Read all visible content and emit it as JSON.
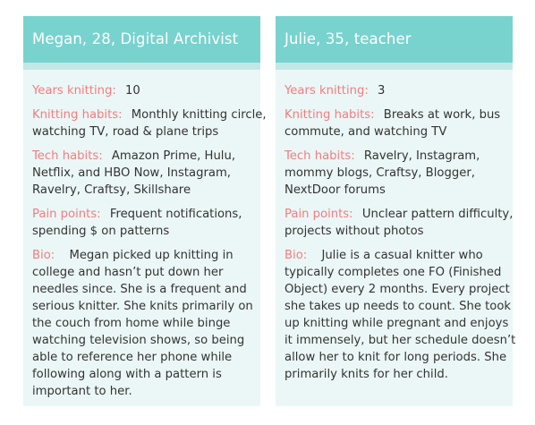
{
  "personas": [
    {
      "title": "Megan, 28, Digital Archivist",
      "fields": [
        {
          "label": "Years knitting:",
          "value": "10"
        },
        {
          "label": "Knitting habits:",
          "value": "Monthly knitting circle, watching TV, road & plane trips"
        },
        {
          "label": "Tech habits:",
          "value": "Amazon Prime, Hulu, Netflix, and HBO Now, Instagram, Ravelry, Craftsy, Skillshare"
        },
        {
          "label": "Pain points:",
          "value": "Frequent notifications, spending $ on patterns"
        },
        {
          "label": "Bio:",
          "value": "Megan picked up knitting in college and hasn’t put down her needles since. She is a frequent and serious knitter. She knits primarily on the couch from home while binge watching television shows, so being able to reference her phone while following along with a pattern is important to her."
        }
      ]
    },
    {
      "title": "Julie, 35, teacher",
      "fields": [
        {
          "label": "Years knitting:",
          "value": "3"
        },
        {
          "label": "Knitting habits:",
          "value": "Breaks at work, bus commute, and watching TV"
        },
        {
          "label": "Tech habits:",
          "value": "Ravelry, Instagram, mommy blogs, Craftsy, Blogger, NextDoor forums"
        },
        {
          "label": "Pain points:",
          "value": "Unclear pattern difficulty, projects without photos"
        },
        {
          "label": "Bio:",
          "value": "Julie is a casual knitter who typically completes one FO (Finished Object) every 2 months. Every project she takes up needs to count. She took up knitting while pregnant and enjoys it immensely, but her schedule doesn’t allow her to knit for long periods. She primarily knits for her child."
        }
      ]
    }
  ],
  "colors": {
    "header": "#78d3cf",
    "stripe": "#c1e8e6",
    "card_background": "#ebf7f6",
    "label": "#f47c80",
    "text": "#333333"
  }
}
